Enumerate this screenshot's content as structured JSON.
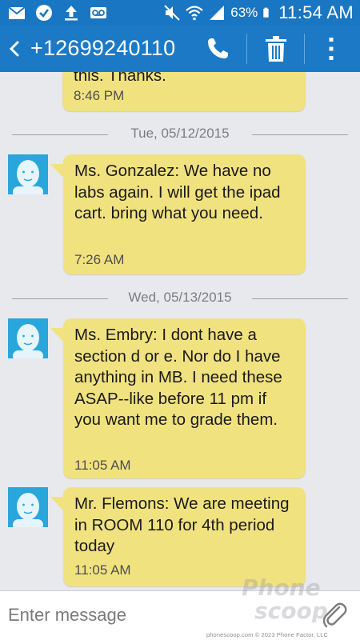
{
  "status_bar": {
    "battery_percent": "63%",
    "time": "11:54 AM",
    "icons": [
      "mail-icon",
      "check-icon",
      "upload-icon",
      "voicemail-icon",
      "mute-icon",
      "wifi-icon",
      "signal-icon",
      "battery-icon"
    ]
  },
  "header": {
    "contact_number": "+12699240110",
    "icons": [
      "back-icon",
      "phone-icon",
      "trash-icon",
      "more-vertical-icon"
    ]
  },
  "messages": [
    {
      "text": "this. Thanks.",
      "time": "8:46 PM"
    },
    {
      "text": "Ms. Gonzalez: We have no labs again. I will get the ipad cart. bring what you need.",
      "time": "7:26 AM"
    },
    {
      "text": "Ms. Embry: I dont have a section d or e. Nor do I have anything in MB. I need these ASAP--like before 11 pm if you want me to grade them.",
      "time": "11:05 AM"
    },
    {
      "text": "Mr. Flemons: We are meeting in ROOM 110 for 4th period today",
      "time": "11:05 AM"
    }
  ],
  "date_separators": [
    "Tue, 05/12/2015",
    "Wed, 05/13/2015"
  ],
  "composer": {
    "placeholder": "Enter message",
    "attach_icon": "paperclip-icon"
  },
  "watermark": {
    "logo": "Phone scoop",
    "credit": "phonescoop.com  © 2023 Phone Factor, LLC"
  },
  "colors": {
    "header_blue": "#1b79c6",
    "bubble_yellow": "#f1e280",
    "avatar_blue": "#29a6dc",
    "thread_bg": "#e8e9ed"
  }
}
